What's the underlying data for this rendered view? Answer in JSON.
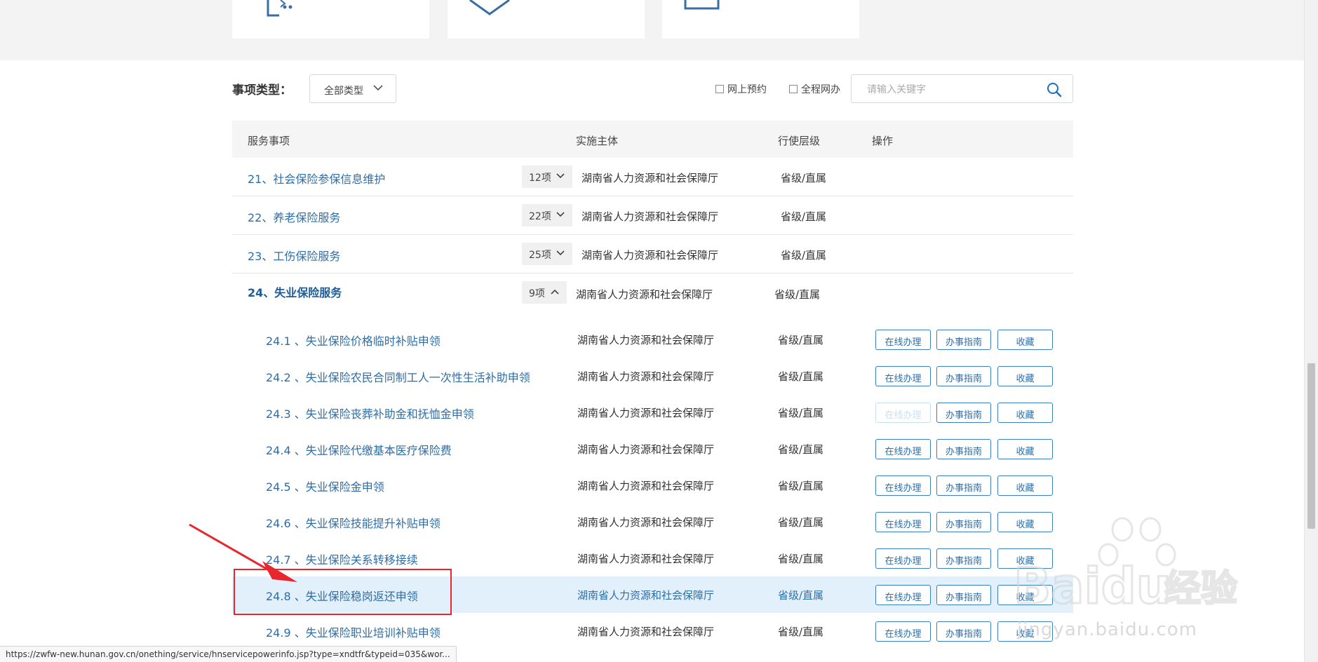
{
  "filter": {
    "label": "事项类型：",
    "type_select": "全部类型",
    "checkbox_online_booking": "网上预约",
    "checkbox_full_online": "全程网办",
    "search_placeholder": "请输入关键字"
  },
  "table": {
    "headers": [
      "服务事项",
      "实施主体",
      "行使层级",
      "操作"
    ],
    "groups": [
      {
        "name": "21、社会保险参保信息维护",
        "count": "12项",
        "org": "湖南省人力资源和社会保障厅",
        "level": "省级/直属"
      },
      {
        "name": "22、养老保险服务",
        "count": "22项",
        "org": "湖南省人力资源和社会保障厅",
        "level": "省级/直属"
      },
      {
        "name": "23、工伤保险服务",
        "count": "25项",
        "org": "湖南省人力资源和社会保障厅",
        "level": "省级/直属"
      },
      {
        "name": "24、失业保险服务",
        "count": "9项",
        "org": "湖南省人力资源和社会保障厅",
        "level": "省级/直属"
      }
    ],
    "subitems": [
      {
        "name": "24.1 、失业保险价格临时补贴申领",
        "org": "湖南省人力资源和社会保障厅",
        "level": "省级/直属"
      },
      {
        "name": "24.2 、失业保险农民合同制工人一次性生活补助申领",
        "org": "湖南省人力资源和社会保障厅",
        "level": "省级/直属"
      },
      {
        "name": "24.3 、失业保险丧葬补助金和抚恤金申领",
        "org": "湖南省人力资源和社会保障厅",
        "level": "省级/直属"
      },
      {
        "name": "24.4 、失业保险代缴基本医疗保险费",
        "org": "湖南省人力资源和社会保障厅",
        "level": "省级/直属"
      },
      {
        "name": "24.5 、失业保险金申领",
        "org": "湖南省人力资源和社会保障厅",
        "level": "省级/直属"
      },
      {
        "name": "24.6 、失业保险技能提升补贴申领",
        "org": "湖南省人力资源和社会保障厅",
        "level": "省级/直属"
      },
      {
        "name": "24.7 、失业保险关系转移接续",
        "org": "湖南省人力资源和社会保障厅",
        "level": "省级/直属"
      },
      {
        "name": "24.8 、失业保险稳岗返还申领",
        "org": "湖南省人力资源和社会保障厅",
        "level": "省级/直属"
      },
      {
        "name": "24.9 、失业保险职业培训补贴申领",
        "org": "湖南省人力资源和社会保障厅",
        "level": "省级/直属"
      }
    ],
    "actions": {
      "online": "在线办理",
      "guide": "办事指南",
      "favorite": "收藏"
    }
  },
  "statusbar": {
    "url": "https://zwfw-new.hunan.gov.cn/onething/service/hnservicepowerinfo.jsp?type=xndtfr&typeid=035&wor..."
  },
  "watermark": {
    "brand": "Baidu",
    "cn": "经验",
    "site": "jingyan.baidu.com"
  },
  "colors": {
    "link": "#2d6ea8",
    "highlight_row": "#e2f0fb",
    "annotation": "#e8262d",
    "button_border": "#3a7fc1"
  }
}
